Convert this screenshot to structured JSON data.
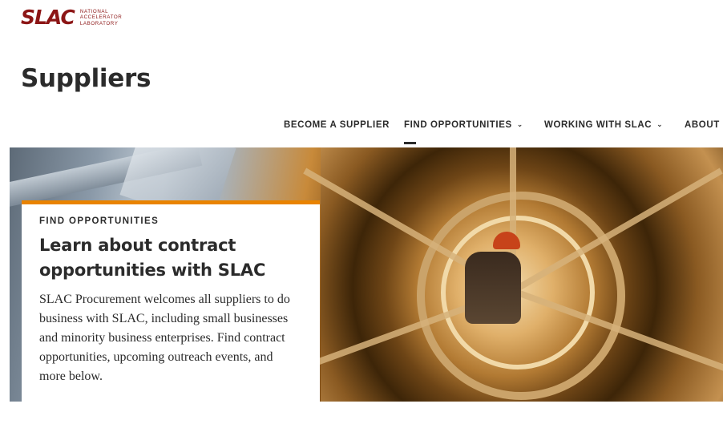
{
  "header": {
    "logo": {
      "word": "SLAC",
      "lines": [
        "NATIONAL",
        "ACCELERATOR",
        "LABORATORY"
      ]
    },
    "page_title": "Suppliers"
  },
  "nav": {
    "items": [
      {
        "label": "BECOME A SUPPLIER",
        "has_dropdown": false
      },
      {
        "label": "FIND OPPORTUNITIES",
        "has_dropdown": true,
        "active": true
      },
      {
        "label": "WORKING WITH SLAC",
        "has_dropdown": true
      },
      {
        "label": "ABOUT &",
        "has_dropdown": false
      }
    ]
  },
  "hero": {
    "eyebrow": "FIND OPPORTUNITIES",
    "title": "Learn about contract opportunities with SLAC",
    "body": "SLAC Procurement welcomes all suppliers to do business with SLAC, including small businesses and minority business enterprises. Find contract opportunities, upcoming outreach events, and more below."
  },
  "colors": {
    "brand_red": "#8c1515",
    "accent_orange": "#e98300",
    "text_dark": "#2b2b2b"
  }
}
